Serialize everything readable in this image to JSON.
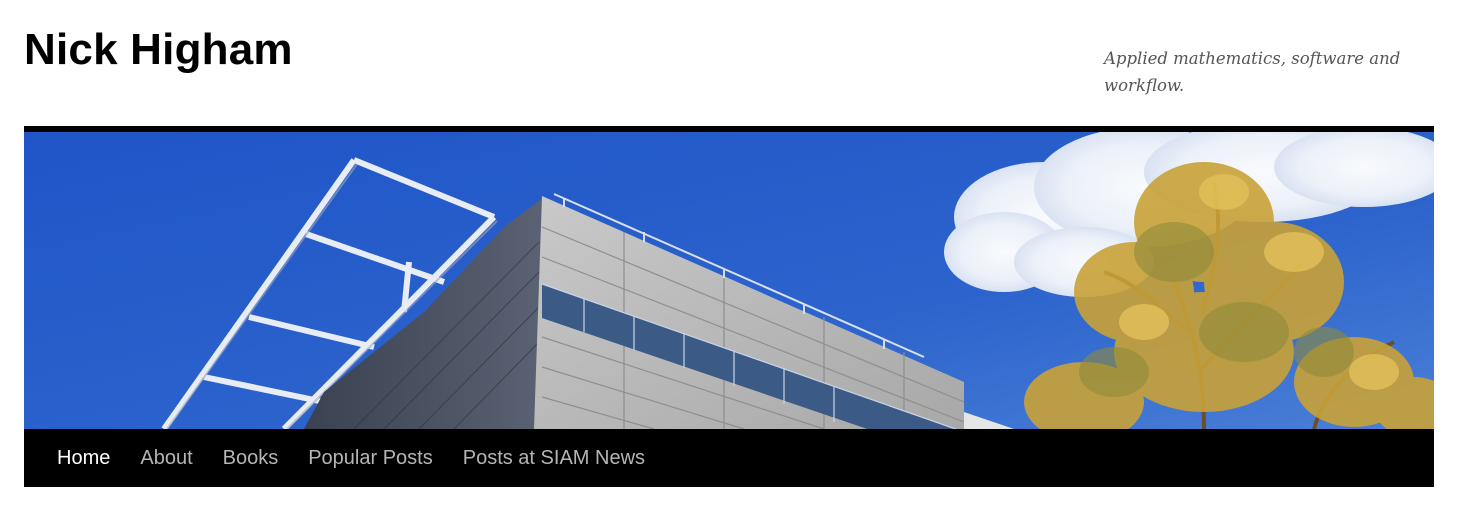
{
  "site": {
    "title": "Nick Higham",
    "tagline": "Applied mathematics, software and workflow."
  },
  "header_image": {
    "subject": "modern-building-and-tree-against-blue-sky"
  },
  "nav": {
    "active_index": 0,
    "items": [
      {
        "label": "Home"
      },
      {
        "label": "About"
      },
      {
        "label": "Books"
      },
      {
        "label": "Popular Posts"
      },
      {
        "label": "Posts at SIAM News"
      }
    ]
  },
  "colors": {
    "nav_background": "#000000",
    "nav_active_text": "#ffffff",
    "nav_text": "#b5b5b5",
    "title_text": "#000000",
    "tagline_text": "#555555",
    "sky": "#2f63c4"
  }
}
